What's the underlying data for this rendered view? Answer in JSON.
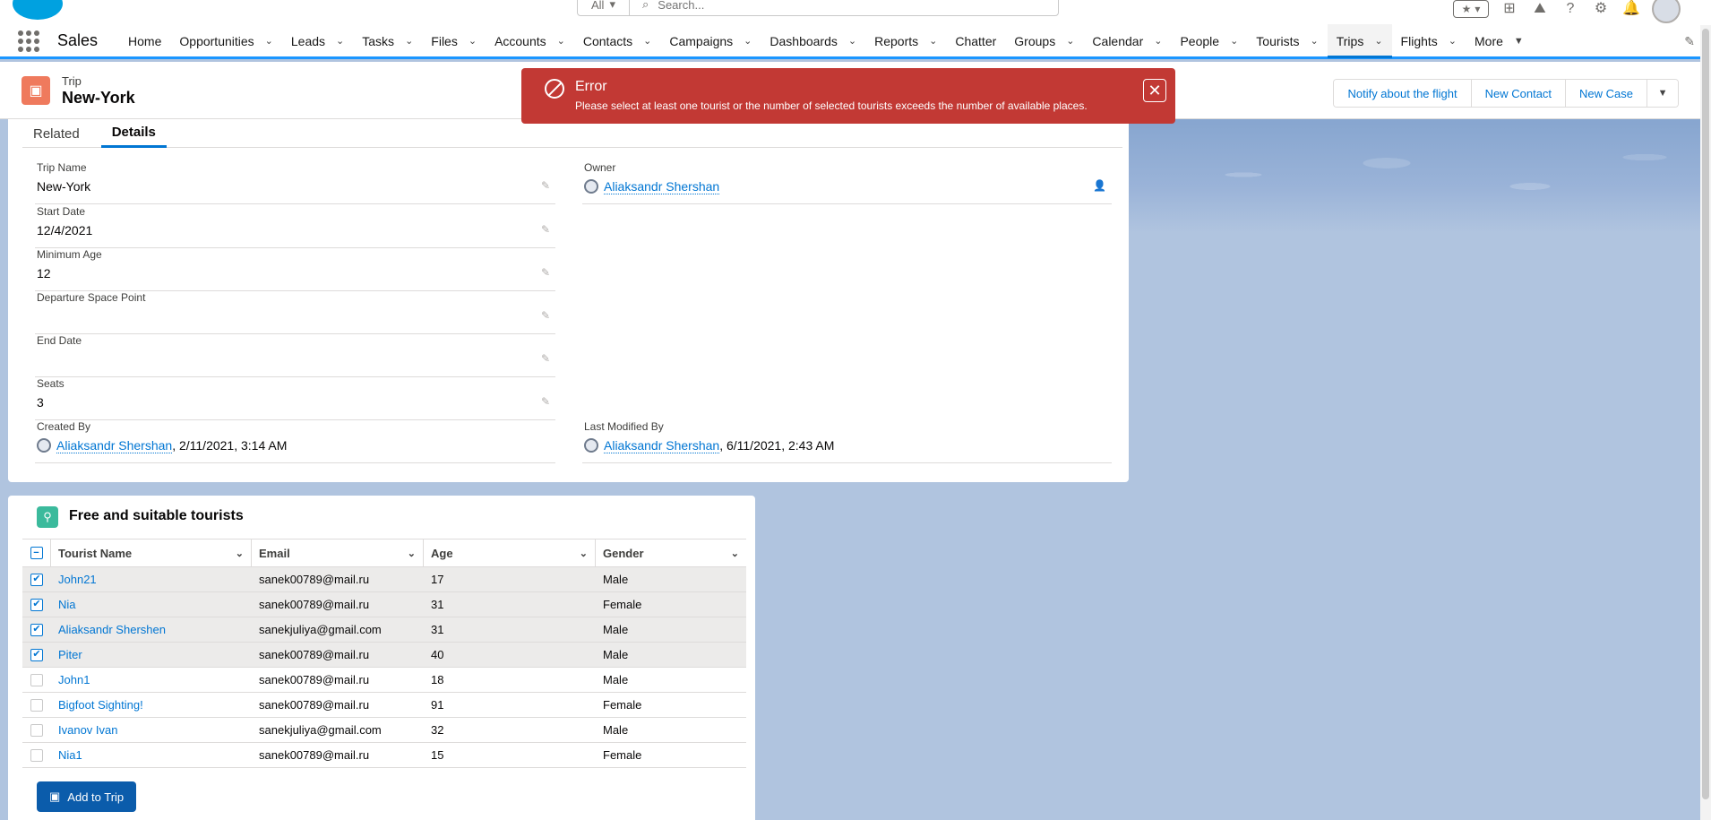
{
  "global_header": {
    "search_scope": "All",
    "search_placeholder": "Search..."
  },
  "nav": {
    "app_name": "Sales",
    "items": [
      {
        "label": "Home",
        "has_menu": false
      },
      {
        "label": "Opportunities",
        "has_menu": true
      },
      {
        "label": "Leads",
        "has_menu": true
      },
      {
        "label": "Tasks",
        "has_menu": true
      },
      {
        "label": "Files",
        "has_menu": true
      },
      {
        "label": "Accounts",
        "has_menu": true
      },
      {
        "label": "Contacts",
        "has_menu": true
      },
      {
        "label": "Campaigns",
        "has_menu": true
      },
      {
        "label": "Dashboards",
        "has_menu": true
      },
      {
        "label": "Reports",
        "has_menu": true
      },
      {
        "label": "Chatter",
        "has_menu": false
      },
      {
        "label": "Groups",
        "has_menu": true
      },
      {
        "label": "Calendar",
        "has_menu": true
      },
      {
        "label": "People",
        "has_menu": true
      },
      {
        "label": "Tourists",
        "has_menu": true
      },
      {
        "label": "Trips",
        "has_menu": true,
        "active": true
      },
      {
        "label": "Flights",
        "has_menu": true
      },
      {
        "label": "More",
        "has_menu": true
      }
    ]
  },
  "record": {
    "type": "Trip",
    "title": "New-York",
    "actions": [
      "Notify about the flight",
      "New Contact",
      "New Case"
    ]
  },
  "toast": {
    "title": "Error",
    "message": "Please select at least one tourist or the number of selected tourists exceeds the number of available places."
  },
  "tabs": {
    "related": "Related",
    "details": "Details"
  },
  "fields": {
    "trip_name": {
      "label": "Trip Name",
      "value": "New-York"
    },
    "owner": {
      "label": "Owner",
      "value": "Aliaksandr Shershan"
    },
    "start_date": {
      "label": "Start Date",
      "value": "12/4/2021"
    },
    "minimum_age": {
      "label": "Minimum Age",
      "value": "12"
    },
    "departure": {
      "label": "Departure Space Point",
      "value": ""
    },
    "end_date": {
      "label": "End Date",
      "value": ""
    },
    "seats": {
      "label": "Seats",
      "value": "3"
    },
    "created_by": {
      "label": "Created By",
      "user": "Aliaksandr Shershan",
      "date": ", 2/11/2021, 3:14 AM"
    },
    "last_modified_by": {
      "label": "Last Modified By",
      "user": "Aliaksandr Shershan",
      "date": ", 6/11/2021, 2:43 AM"
    }
  },
  "tourists": {
    "title": "Free and suitable tourists",
    "columns": [
      "Tourist Name",
      "Email",
      "Age",
      "Gender"
    ],
    "rows": [
      {
        "name": "John21",
        "email": "sanek00789@mail.ru",
        "age": "17",
        "gender": "Male",
        "selected": true
      },
      {
        "name": "Nia",
        "email": "sanek00789@mail.ru",
        "age": "31",
        "gender": "Female",
        "selected": true
      },
      {
        "name": "Aliaksandr Shershen",
        "email": "sanekjuliya@gmail.com",
        "age": "31",
        "gender": "Male",
        "selected": true
      },
      {
        "name": "Piter",
        "email": "sanek00789@mail.ru",
        "age": "40",
        "gender": "Male",
        "selected": true
      },
      {
        "name": "John1",
        "email": "sanek00789@mail.ru",
        "age": "18",
        "gender": "Male",
        "selected": false
      },
      {
        "name": "Bigfoot Sighting!",
        "email": "sanek00789@mail.ru",
        "age": "91",
        "gender": "Female",
        "selected": false
      },
      {
        "name": "Ivanov Ivan",
        "email": "sanekjuliya@gmail.com",
        "age": "32",
        "gender": "Male",
        "selected": false
      },
      {
        "name": "Nia1",
        "email": "sanek00789@mail.ru",
        "age": "15",
        "gender": "Female",
        "selected": false
      }
    ],
    "add_button": "Add to Trip"
  }
}
